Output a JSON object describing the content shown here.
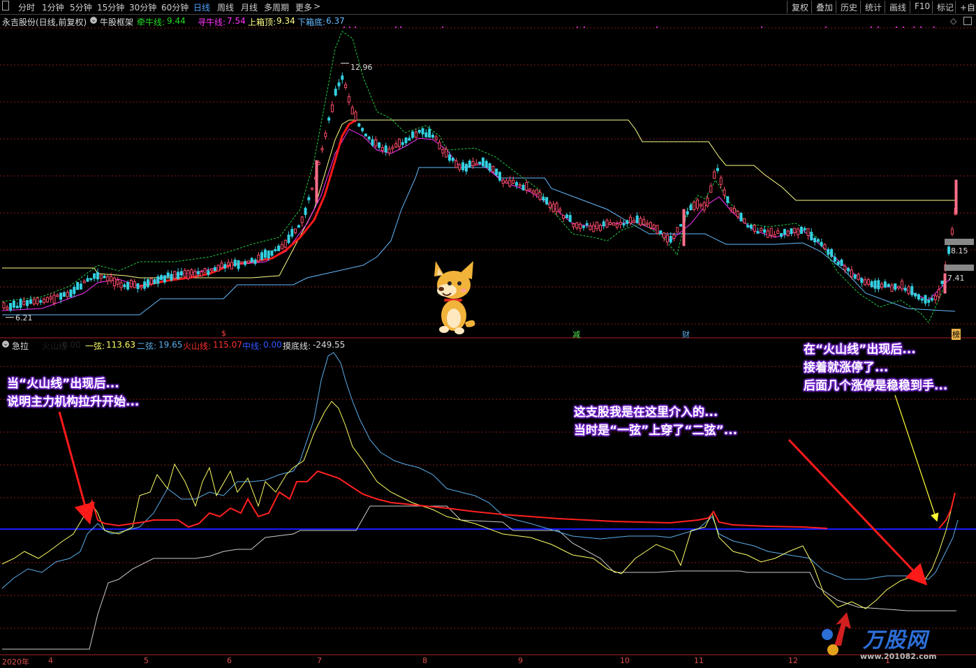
{
  "toolbar": {
    "periods": [
      "分时",
      "1分钟",
      "5分钟",
      "15分钟",
      "30分钟",
      "60分钟",
      "日线",
      "周线",
      "月线",
      "多周期",
      "更多"
    ],
    "active_period": "日线",
    "right_buttons": [
      "复权",
      "叠加",
      "历史",
      "统计",
      "画线",
      "F10",
      "标记",
      "+自选"
    ]
  },
  "stock": {
    "name": "永吉股份(日线,前复权)",
    "indicator": "牛股框架",
    "qianniu_label": "牵牛线:",
    "qianniu_value": "9.44",
    "xunniu_label": "寻牛线:",
    "xunniu_value": "7.54",
    "upper_label": "上箱顶:",
    "upper_value": "9.34",
    "lower_label": "下箱底:",
    "lower_value": "6.37"
  },
  "price_marks": {
    "high": "12.96",
    "low": "6.21",
    "right_top": "8.15",
    "right_bottom": "7.41"
  },
  "event_marks": [
    "$",
    "减",
    "财",
    "榜"
  ],
  "sub_indicator": {
    "name": "急拉",
    "volcano_short": "火山线",
    "volcano_short_value": "0.00",
    "yixian_label": "一弦:",
    "yixian_value": "113.63",
    "erxian_label": "二弦:",
    "erxian_value": "19.65",
    "volcano_label": "火山线:",
    "volcano_value": "115.07",
    "mid_label": "中线:",
    "mid_value": "0.00",
    "bottom_label": "摸底线:",
    "bottom_value": "-249.55"
  },
  "annotations": {
    "left_line1": "当“火山线”出现后...",
    "left_line2": "说明主力机构拉升开始...",
    "mid_line1": "这支股我是在这里介入的...",
    "mid_line2": "当时是“一弦”上穿了“二弦”...",
    "right_line1": "在“火山线”出现后...",
    "right_line2": "接着就涨停了...",
    "right_line3": "后面几个涨停是稳稳到手..."
  },
  "x_axis": [
    "2020年",
    "4",
    "5",
    "6",
    "7",
    "8",
    "9",
    "10",
    "11",
    "12",
    "1"
  ],
  "watermark": {
    "brand": "万股网",
    "url": "www.201082.com"
  },
  "colors": {
    "up": "#ff4d6a",
    "down": "#33d0e0",
    "yixian": "#ffff66",
    "erxian": "#5aaeea",
    "volcano": "#ff2020",
    "midline": "#1a1aff",
    "grid": "#8a1a1a",
    "annotation_glow": "#7a2bd6"
  }
}
